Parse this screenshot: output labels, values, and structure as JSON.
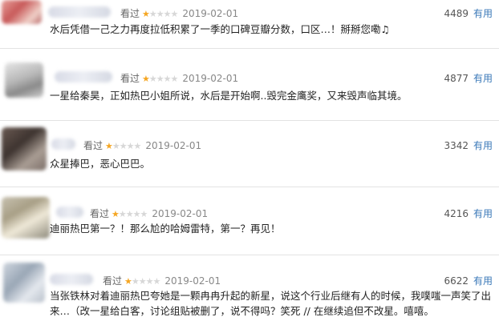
{
  "reviews": [
    {
      "status": "看过",
      "rating": 1,
      "max_rating": 5,
      "date": "2019-02-01",
      "votes": "4489",
      "useful_label": "有用",
      "content": "水后凭借一己之力再度拉低积累了一季的口碑豆瓣分数，口区…！掰掰您嘞♫"
    },
    {
      "status": "看过",
      "rating": 1,
      "max_rating": 5,
      "date": "2019-02-01",
      "votes": "4877",
      "useful_label": "有用",
      "content": "一星给秦昊，正如热巴小姐所说，水后是开始啊..毁完金鹰奖，又来毁声临其境。"
    },
    {
      "status": "看过",
      "rating": 1,
      "max_rating": 5,
      "date": "2019-02-01",
      "votes": "3342",
      "useful_label": "有用",
      "content": "众星捧巴，恶心巴巴。"
    },
    {
      "status": "看过",
      "rating": 1,
      "max_rating": 5,
      "date": "2019-02-01",
      "votes": "4216",
      "useful_label": "有用",
      "content": "迪丽热巴第一？！那么尬的哈姆雷特，第一？再见！"
    },
    {
      "status": "看过",
      "rating": 1,
      "max_rating": 5,
      "date": "2019-02-01",
      "votes": "6622",
      "useful_label": "有用",
      "content_line1": "当张铁林对着迪丽热巴夸她是一颗冉冉升起的新星，说这个行业后继有人的时候，我噗嗤一声笑了出",
      "content_line2": "来…（改一星给白客，讨论组贴被删了，说不得吗？笑死 // 在继续追但不改星。嘻嘻。"
    }
  ]
}
